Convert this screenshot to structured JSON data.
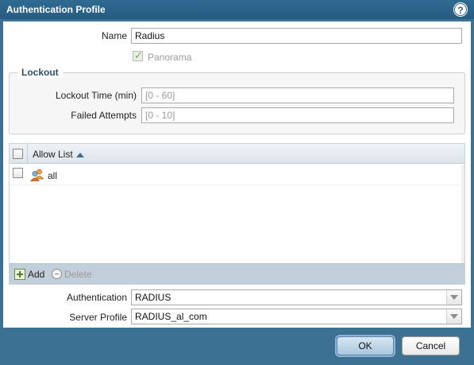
{
  "window": {
    "title": "Authentication Profile",
    "help_icon": "help-icon",
    "help_glyph": "?"
  },
  "form": {
    "name_label": "Name",
    "name_value": "Radius",
    "panorama_label": "Panorama",
    "panorama_checked": true,
    "lockout": {
      "legend": "Lockout",
      "time_label": "Lockout Time (min)",
      "time_placeholder": "[0 - 60]",
      "attempts_label": "Failed Attempts",
      "attempts_placeholder": "[0 - 10]"
    },
    "allow_list": {
      "column_header": "Allow List",
      "rows": [
        {
          "icon": "users-icon",
          "label": "all",
          "checked": false
        }
      ],
      "add_label": "Add",
      "delete_label": "Delete"
    },
    "authentication_label": "Authentication",
    "authentication_value": "RADIUS",
    "server_profile_label": "Server Profile",
    "server_profile_value": "RADIUS_al_com"
  },
  "buttons": {
    "ok": "OK",
    "cancel": "Cancel"
  },
  "colors": {
    "title_bar": "#275b80",
    "window_bg": "#3d7194",
    "legend_text": "#2e4f67",
    "toolbar_bg": "#c2cfda"
  }
}
